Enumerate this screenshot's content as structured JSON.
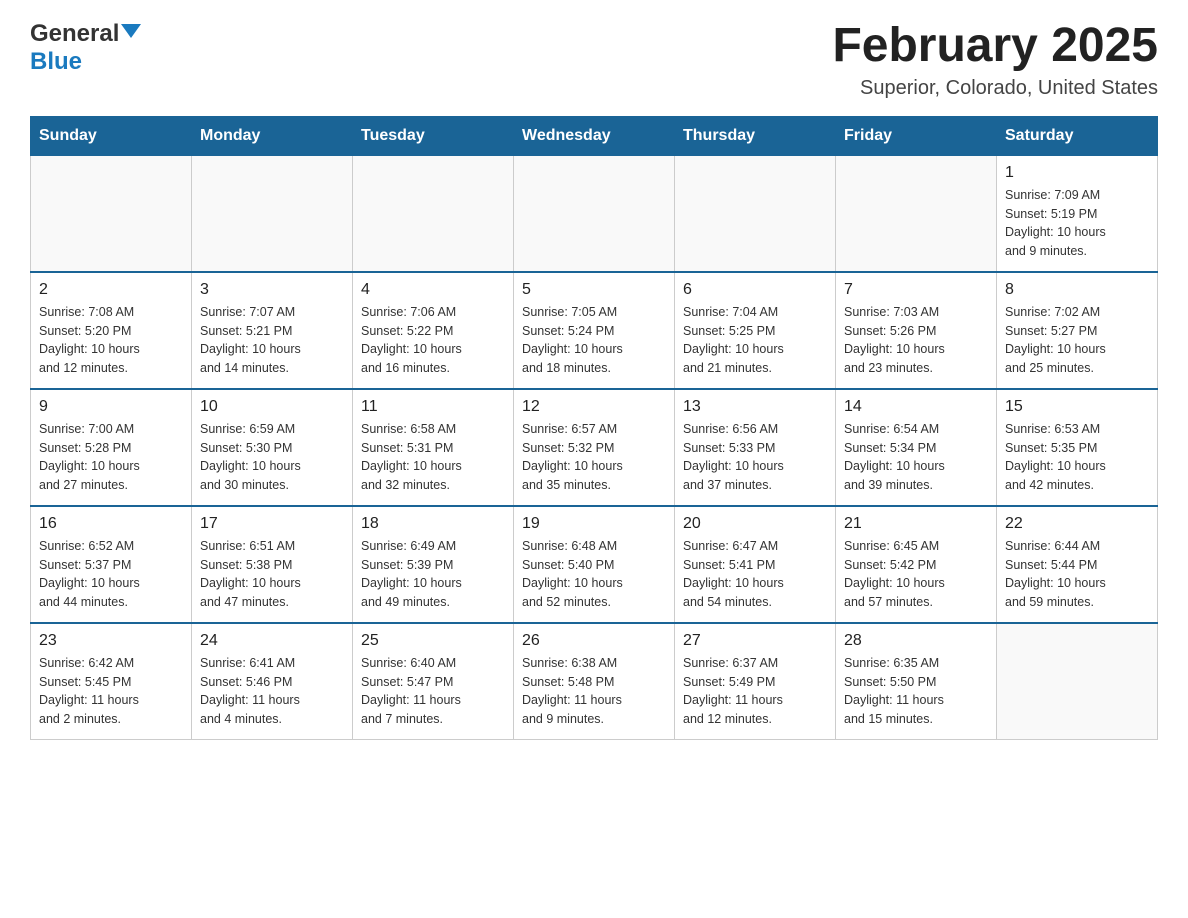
{
  "header": {
    "logo_general": "General",
    "logo_blue": "Blue",
    "month_title": "February 2025",
    "location": "Superior, Colorado, United States"
  },
  "days_of_week": [
    "Sunday",
    "Monday",
    "Tuesday",
    "Wednesday",
    "Thursday",
    "Friday",
    "Saturday"
  ],
  "weeks": [
    [
      {
        "day": "",
        "info": ""
      },
      {
        "day": "",
        "info": ""
      },
      {
        "day": "",
        "info": ""
      },
      {
        "day": "",
        "info": ""
      },
      {
        "day": "",
        "info": ""
      },
      {
        "day": "",
        "info": ""
      },
      {
        "day": "1",
        "info": "Sunrise: 7:09 AM\nSunset: 5:19 PM\nDaylight: 10 hours\nand 9 minutes."
      }
    ],
    [
      {
        "day": "2",
        "info": "Sunrise: 7:08 AM\nSunset: 5:20 PM\nDaylight: 10 hours\nand 12 minutes."
      },
      {
        "day": "3",
        "info": "Sunrise: 7:07 AM\nSunset: 5:21 PM\nDaylight: 10 hours\nand 14 minutes."
      },
      {
        "day": "4",
        "info": "Sunrise: 7:06 AM\nSunset: 5:22 PM\nDaylight: 10 hours\nand 16 minutes."
      },
      {
        "day": "5",
        "info": "Sunrise: 7:05 AM\nSunset: 5:24 PM\nDaylight: 10 hours\nand 18 minutes."
      },
      {
        "day": "6",
        "info": "Sunrise: 7:04 AM\nSunset: 5:25 PM\nDaylight: 10 hours\nand 21 minutes."
      },
      {
        "day": "7",
        "info": "Sunrise: 7:03 AM\nSunset: 5:26 PM\nDaylight: 10 hours\nand 23 minutes."
      },
      {
        "day": "8",
        "info": "Sunrise: 7:02 AM\nSunset: 5:27 PM\nDaylight: 10 hours\nand 25 minutes."
      }
    ],
    [
      {
        "day": "9",
        "info": "Sunrise: 7:00 AM\nSunset: 5:28 PM\nDaylight: 10 hours\nand 27 minutes."
      },
      {
        "day": "10",
        "info": "Sunrise: 6:59 AM\nSunset: 5:30 PM\nDaylight: 10 hours\nand 30 minutes."
      },
      {
        "day": "11",
        "info": "Sunrise: 6:58 AM\nSunset: 5:31 PM\nDaylight: 10 hours\nand 32 minutes."
      },
      {
        "day": "12",
        "info": "Sunrise: 6:57 AM\nSunset: 5:32 PM\nDaylight: 10 hours\nand 35 minutes."
      },
      {
        "day": "13",
        "info": "Sunrise: 6:56 AM\nSunset: 5:33 PM\nDaylight: 10 hours\nand 37 minutes."
      },
      {
        "day": "14",
        "info": "Sunrise: 6:54 AM\nSunset: 5:34 PM\nDaylight: 10 hours\nand 39 minutes."
      },
      {
        "day": "15",
        "info": "Sunrise: 6:53 AM\nSunset: 5:35 PM\nDaylight: 10 hours\nand 42 minutes."
      }
    ],
    [
      {
        "day": "16",
        "info": "Sunrise: 6:52 AM\nSunset: 5:37 PM\nDaylight: 10 hours\nand 44 minutes."
      },
      {
        "day": "17",
        "info": "Sunrise: 6:51 AM\nSunset: 5:38 PM\nDaylight: 10 hours\nand 47 minutes."
      },
      {
        "day": "18",
        "info": "Sunrise: 6:49 AM\nSunset: 5:39 PM\nDaylight: 10 hours\nand 49 minutes."
      },
      {
        "day": "19",
        "info": "Sunrise: 6:48 AM\nSunset: 5:40 PM\nDaylight: 10 hours\nand 52 minutes."
      },
      {
        "day": "20",
        "info": "Sunrise: 6:47 AM\nSunset: 5:41 PM\nDaylight: 10 hours\nand 54 minutes."
      },
      {
        "day": "21",
        "info": "Sunrise: 6:45 AM\nSunset: 5:42 PM\nDaylight: 10 hours\nand 57 minutes."
      },
      {
        "day": "22",
        "info": "Sunrise: 6:44 AM\nSunset: 5:44 PM\nDaylight: 10 hours\nand 59 minutes."
      }
    ],
    [
      {
        "day": "23",
        "info": "Sunrise: 6:42 AM\nSunset: 5:45 PM\nDaylight: 11 hours\nand 2 minutes."
      },
      {
        "day": "24",
        "info": "Sunrise: 6:41 AM\nSunset: 5:46 PM\nDaylight: 11 hours\nand 4 minutes."
      },
      {
        "day": "25",
        "info": "Sunrise: 6:40 AM\nSunset: 5:47 PM\nDaylight: 11 hours\nand 7 minutes."
      },
      {
        "day": "26",
        "info": "Sunrise: 6:38 AM\nSunset: 5:48 PM\nDaylight: 11 hours\nand 9 minutes."
      },
      {
        "day": "27",
        "info": "Sunrise: 6:37 AM\nSunset: 5:49 PM\nDaylight: 11 hours\nand 12 minutes."
      },
      {
        "day": "28",
        "info": "Sunrise: 6:35 AM\nSunset: 5:50 PM\nDaylight: 11 hours\nand 15 minutes."
      },
      {
        "day": "",
        "info": ""
      }
    ]
  ]
}
